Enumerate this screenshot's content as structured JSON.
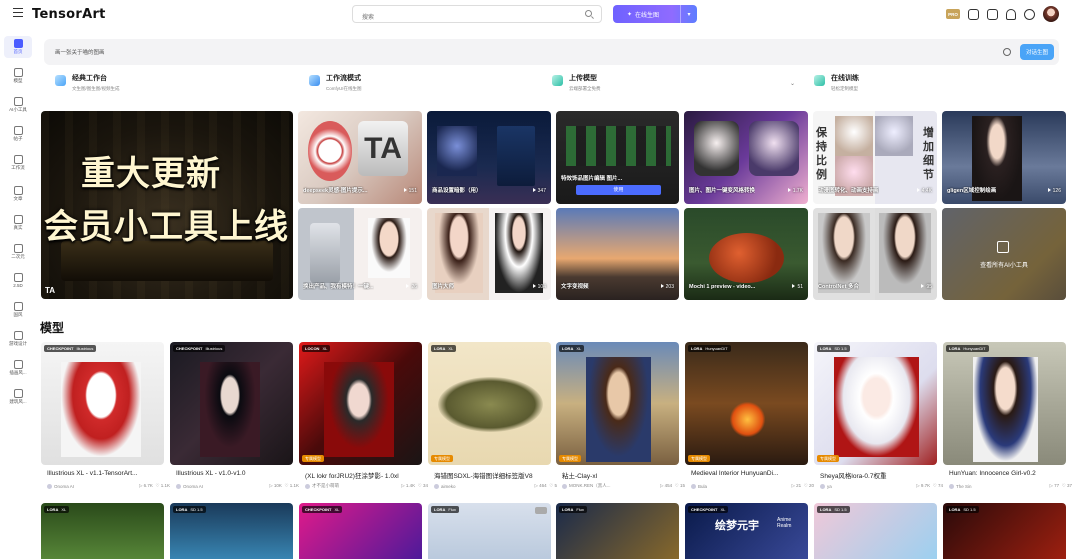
{
  "header": {
    "logo": "TensorArt",
    "search_placeholder": "搜索",
    "generate_label": "在线生图",
    "pro_badge": "PRO"
  },
  "leftnav": {
    "items": [
      {
        "label": "首页",
        "active": true
      },
      {
        "label": "模型"
      },
      {
        "label": "AI小工具"
      },
      {
        "label": "帖子"
      },
      {
        "label": "工作流"
      },
      {
        "label": "文章"
      },
      {
        "label": "真实"
      },
      {
        "label": "二次元"
      },
      {
        "label": "2.5D"
      },
      {
        "label": "国风"
      },
      {
        "label": "游戏设计"
      },
      {
        "label": "插画风..."
      },
      {
        "label": "建筑风..."
      }
    ]
  },
  "prompt": {
    "placeholder": "画一张关于喵的图画",
    "chat_button": "对话生图"
  },
  "features": [
    {
      "title": "经典工作台",
      "sub": "文生图/图生图/视频生成",
      "color": "#4aa4f7"
    },
    {
      "title": "工作流模式",
      "sub": "ComfyUI在线生图",
      "color": "#4aa4f7"
    },
    {
      "title": "上传模型",
      "sub": "云端部署全免费",
      "color": "#36c6b0"
    },
    {
      "title": "在线训练",
      "sub": "轻松定制模型",
      "color": "#36c6b0"
    }
  ],
  "banner": {
    "line1": "重大更新",
    "line2": "会员小工具上线",
    "logo": "TA"
  },
  "tools_row1": [
    {
      "title": "deepseek灵感-图片提示...",
      "count": "151"
    },
    {
      "title": "商品设置暗影（用）",
      "count": "347"
    },
    {
      "title": "特效饰品图片编辑 图片...",
      "count": "",
      "button": "使用"
    },
    {
      "title": "图片、图片一键变风格转换",
      "count": "1.7K"
    },
    {
      "title": "动漫图转化、动画支持画",
      "count": "4.4K"
    },
    {
      "title": "gligen区域控制绘画",
      "count": "126"
    }
  ],
  "tools_row2": [
    {
      "title": "换出产品、我有模特！一键...",
      "count": "26"
    },
    {
      "title": "图片大师",
      "count": "104"
    },
    {
      "title": "文字变视频",
      "count": "203"
    },
    {
      "title": "Mochi 1 preview - video...",
      "count": "51"
    },
    {
      "title": "ControlNet 多合",
      "count": "95"
    },
    {
      "title": "查看所有AI小工具",
      "count": ""
    }
  ],
  "section_title": "模型",
  "models": [
    {
      "type": "CHECKPOINT",
      "base": "Illustrious",
      "name": "Illustrious XL - v1.1-TensorArt...",
      "author": "Onoma AI",
      "runs": "6.7K",
      "likes": "1.1K",
      "tag": ""
    },
    {
      "type": "CHECKPOINT",
      "base": "Illustrious",
      "name": "Illustrious XL - v1.0-v1.0",
      "author": "Onoma AI",
      "runs": "10K",
      "likes": "1.1K",
      "tag": ""
    },
    {
      "type": "LOCON",
      "base": "XL",
      "name": "(XL lokr forJRU2)狂涂梦影- 1.0xl",
      "author": "才不是小萌萌",
      "runs": "1.4K",
      "likes": "34",
      "tag": "专属模型"
    },
    {
      "type": "LORA",
      "base": "XL",
      "name": "海错图SDXL-海错图详细标签版V8",
      "author": "aimeko",
      "runs": "464",
      "likes": "5",
      "tag": "专属模型"
    },
    {
      "type": "LORA",
      "base": "XL",
      "name": "粘土-Clay-xl",
      "author": "MONK.REN（黑人...",
      "runs": "454",
      "likes": "15",
      "tag": "专属模型"
    },
    {
      "type": "LORA",
      "base": "HunyuanDiT",
      "name": "Medieval Interior HunyuanDi...",
      "author": "Bula",
      "runs": "21",
      "likes": "20",
      "tag": "专属模型"
    },
    {
      "type": "LORA",
      "base": "SD 1.5",
      "name": "Sheya风格lora-0.7权重",
      "author": "ya",
      "runs": "9.7K",
      "likes": "74",
      "tag": "专属模型"
    },
    {
      "type": "LORA",
      "base": "HunyuanDiT",
      "name": "HunYuan: Innocence Girl-v0.2",
      "author": "The Sin",
      "runs": "77",
      "likes": "37",
      "tag": ""
    }
  ],
  "models_row2": [
    {
      "type": "LORA",
      "base": "XL"
    },
    {
      "type": "LORA",
      "base": "SD 1.5"
    },
    {
      "type": "CHECKPOINT",
      "base": "XL"
    },
    {
      "type": "LORA",
      "base": "Flux"
    },
    {
      "type": "LORA",
      "base": "Flux"
    },
    {
      "type": "CHECKPOINT",
      "base": "XL",
      "overlay": "绘梦元宇",
      "overlay2": "Anime Realm"
    },
    {
      "type": "LORA",
      "base": "SD 1.5"
    },
    {
      "type": "LORA",
      "base": "SD 1.5"
    }
  ]
}
